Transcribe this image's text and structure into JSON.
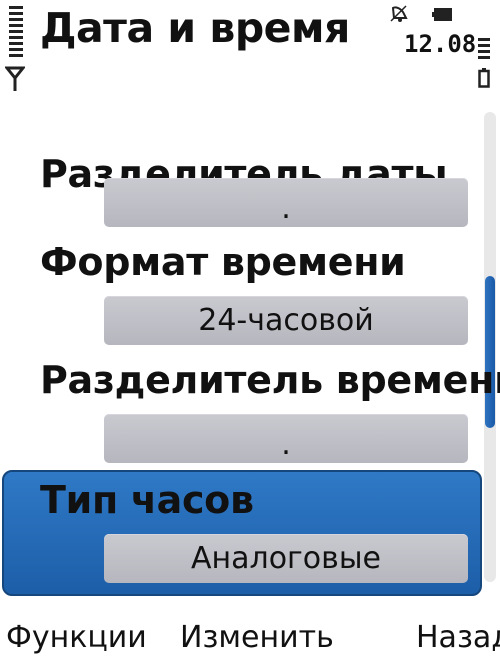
{
  "header": {
    "title": "Дата и время",
    "clock": "12.08"
  },
  "icons": {
    "signal": "signal-strength-icon",
    "antenna": "antenna-icon",
    "alarm": "alarm-icon",
    "battery_status": "battery-status-icon",
    "battery": "battery-icon"
  },
  "settings": [
    {
      "label": "Разделитель даты",
      "value": "."
    },
    {
      "label": "Формат времени",
      "value": "24-часовой"
    },
    {
      "label": "Разделитель времени",
      "value": "."
    },
    {
      "label": "Тип часов",
      "value": "Аналоговые",
      "selected": true
    }
  ],
  "softkeys": {
    "left": "Функции",
    "middle": "Изменить",
    "right": "Назад"
  },
  "colors": {
    "selection": "#2a6fbb",
    "value_field": "#c0c0c6",
    "scrollbar_thumb": "#2f74c0"
  }
}
